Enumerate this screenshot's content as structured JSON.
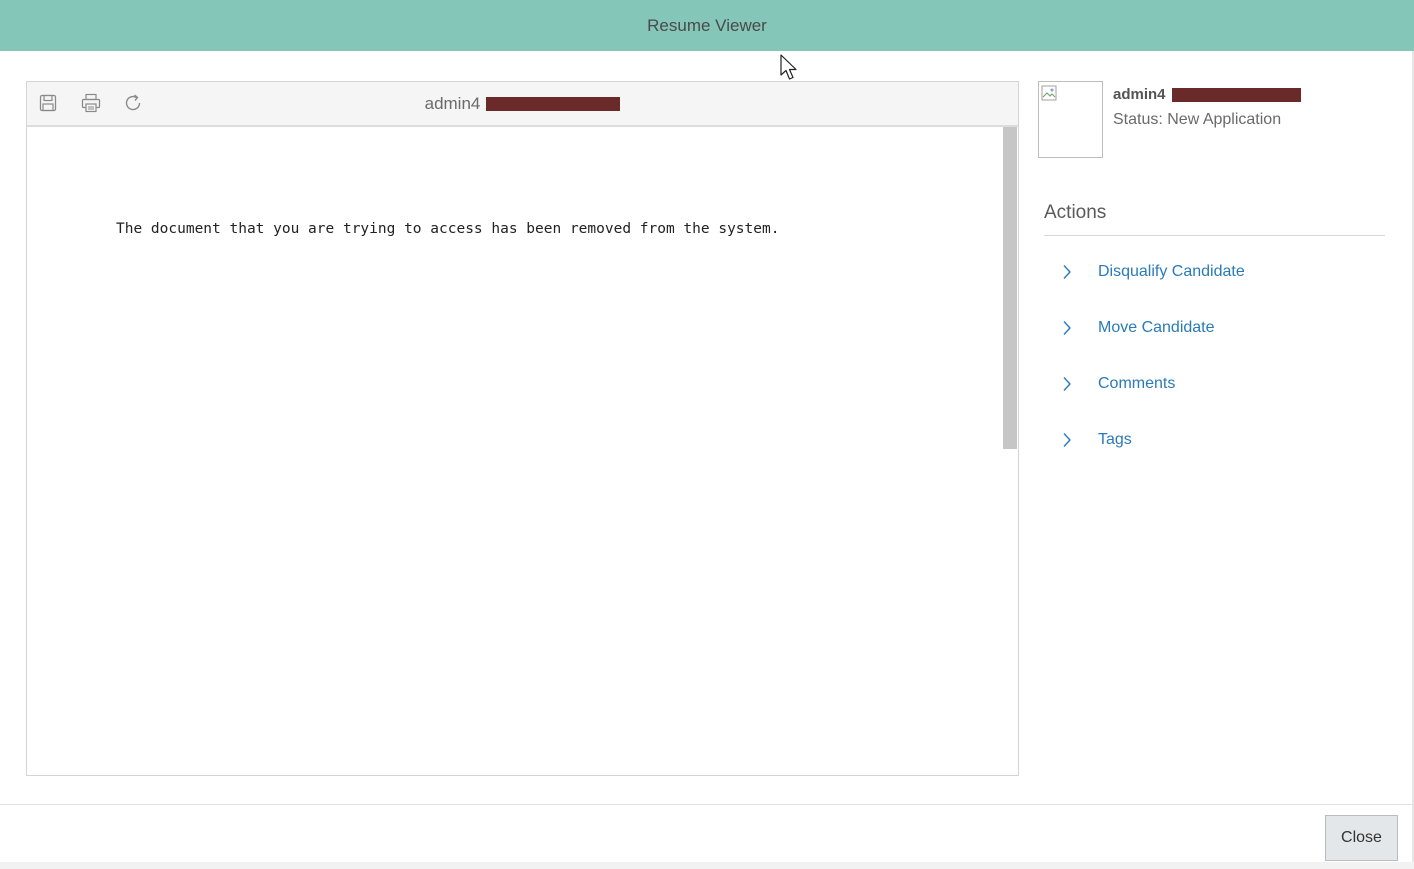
{
  "window": {
    "title": "Resume Viewer"
  },
  "viewer": {
    "toolbar": {
      "icons": [
        "save-icon",
        "print-icon",
        "refresh-icon"
      ],
      "document_title": "admin4"
    },
    "message": "The document that you are trying to access has been removed from the system."
  },
  "candidate": {
    "name": "admin4",
    "status": "Status: New Application"
  },
  "actions": {
    "title": "Actions",
    "items": [
      {
        "label": "Disqualify Candidate",
        "icon": "chevron-right-icon"
      },
      {
        "label": "Move Candidate",
        "icon": "chevron-right-icon"
      },
      {
        "label": "Comments",
        "icon": "chevron-right-icon"
      },
      {
        "label": "Tags",
        "icon": "chevron-right-icon"
      }
    ]
  },
  "footer": {
    "close_label": "Close"
  },
  "colors": {
    "titlebar": "#84c6b8",
    "link": "#2a7ab8",
    "redaction": "#6b2a2a"
  }
}
